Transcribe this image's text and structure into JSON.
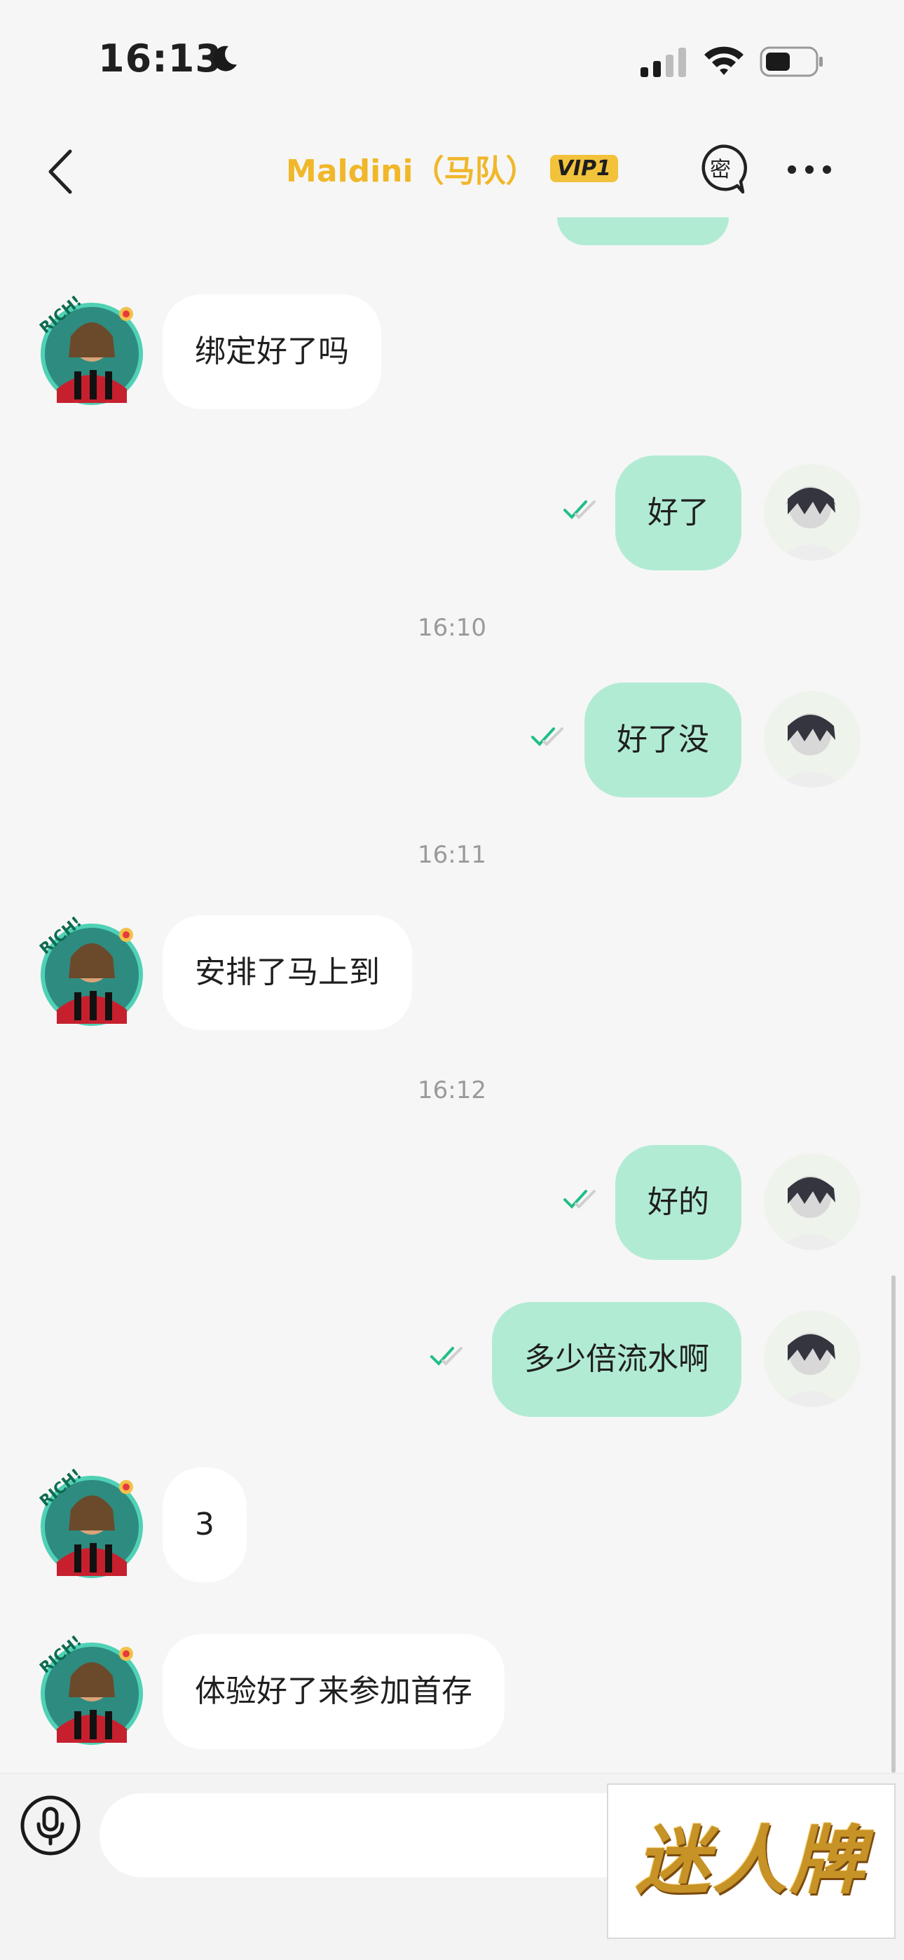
{
  "status_bar": {
    "time": "16:13",
    "icons": [
      "moon-icon",
      "signal-icon",
      "wifi-icon",
      "battery-icon"
    ]
  },
  "header": {
    "title": "Maldini（马队）",
    "vip_badge": "VIP1",
    "secret_icon_label": "密",
    "colors": {
      "title": "#f0b72a",
      "vip_bg": "#f2c23a"
    }
  },
  "messages": [
    {
      "direction": "in",
      "text": "绑定好了吗"
    },
    {
      "direction": "out",
      "text": "好了",
      "read": true
    },
    {
      "type": "timestamp",
      "text": "16:10"
    },
    {
      "direction": "out",
      "text": "好了没",
      "read": true
    },
    {
      "type": "timestamp",
      "text": "16:11"
    },
    {
      "direction": "in",
      "text": "安排了马上到"
    },
    {
      "type": "timestamp",
      "text": "16:12"
    },
    {
      "direction": "out",
      "text": "好的",
      "read": true
    },
    {
      "direction": "out",
      "text": "多少倍流水啊",
      "read": true
    },
    {
      "direction": "in",
      "text": "3"
    },
    {
      "direction": "in",
      "text": "体验好了来参加首存"
    }
  ],
  "input_bar": {
    "placeholder": "",
    "mic_icon": "mic-icon"
  },
  "watermark": {
    "text": "迷人牌"
  },
  "colors": {
    "outgoing_bubble": "#b2ebd4",
    "incoming_bubble": "#ffffff",
    "read_check": "#1fbf85",
    "background": "#f6f6f6"
  }
}
